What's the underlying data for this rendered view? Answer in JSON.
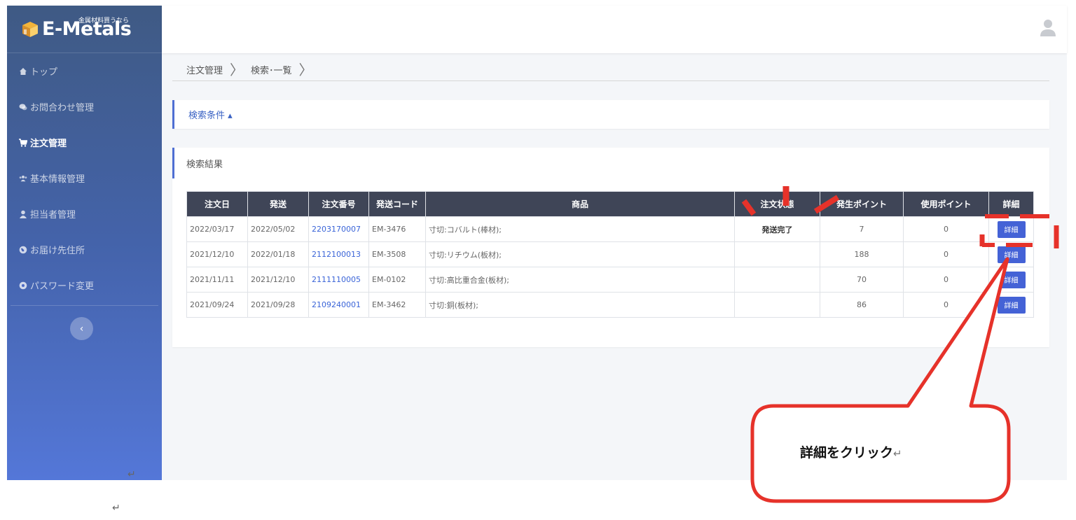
{
  "logo": {
    "name": "E-Metals",
    "tagline": "金属材料買うなら"
  },
  "sidebar": {
    "items": [
      {
        "label": "トップ",
        "icon": "home-icon",
        "active": false
      },
      {
        "label": "お問合わせ管理",
        "icon": "chat-icon",
        "active": false
      },
      {
        "label": "注文管理",
        "icon": "cart-icon",
        "active": true
      },
      {
        "label": "基本情報管理",
        "icon": "group-icon",
        "active": false
      },
      {
        "label": "担当者管理",
        "icon": "user-icon",
        "active": false
      },
      {
        "label": "お届け先住所",
        "icon": "globe-icon",
        "active": false
      },
      {
        "label": "パスワード変更",
        "icon": "gear-icon",
        "active": false
      }
    ],
    "collapse_label": "‹"
  },
  "breadcrumb": [
    "注文管理",
    "検索･一覧"
  ],
  "search_panel": {
    "label": "検索条件 ▴"
  },
  "results": {
    "title": "検索結果",
    "columns": [
      "注文日",
      "発送",
      "注文番号",
      "発送コード",
      "商品",
      "注文状態",
      "発生ポイント",
      "使用ポイント",
      "詳細"
    ],
    "rows": [
      {
        "order_date": "2022/03/17",
        "ship_date": "2022/05/02",
        "order_no": "2203170007",
        "ship_code": "EM-3476",
        "product": "寸切:コバルト(棒材);",
        "status": "発送完了",
        "earned": "7",
        "used": "0",
        "detail": "詳細"
      },
      {
        "order_date": "2021/12/10",
        "ship_date": "2022/01/18",
        "order_no": "2112100013",
        "ship_code": "EM-3508",
        "product": "寸切:リチウム(板材);",
        "status": "",
        "earned": "188",
        "used": "0",
        "detail": "詳細"
      },
      {
        "order_date": "2021/11/11",
        "ship_date": "2021/12/10",
        "order_no": "2111110005",
        "ship_code": "EM-0102",
        "product": "寸切:高比重合金(板材);",
        "status": "",
        "earned": "70",
        "used": "0",
        "detail": "詳細"
      },
      {
        "order_date": "2021/09/24",
        "ship_date": "2021/09/28",
        "order_no": "2109240001",
        "ship_code": "EM-3462",
        "product": "寸切:銅(板材);",
        "status": "",
        "earned": "86",
        "used": "0",
        "detail": "詳細"
      }
    ]
  },
  "callout": {
    "text": "詳細をクリック",
    "return_mark": "↵"
  },
  "colors": {
    "accent": "#4462d6",
    "annotation": "#e6322a",
    "table_header": "#3f4557"
  }
}
